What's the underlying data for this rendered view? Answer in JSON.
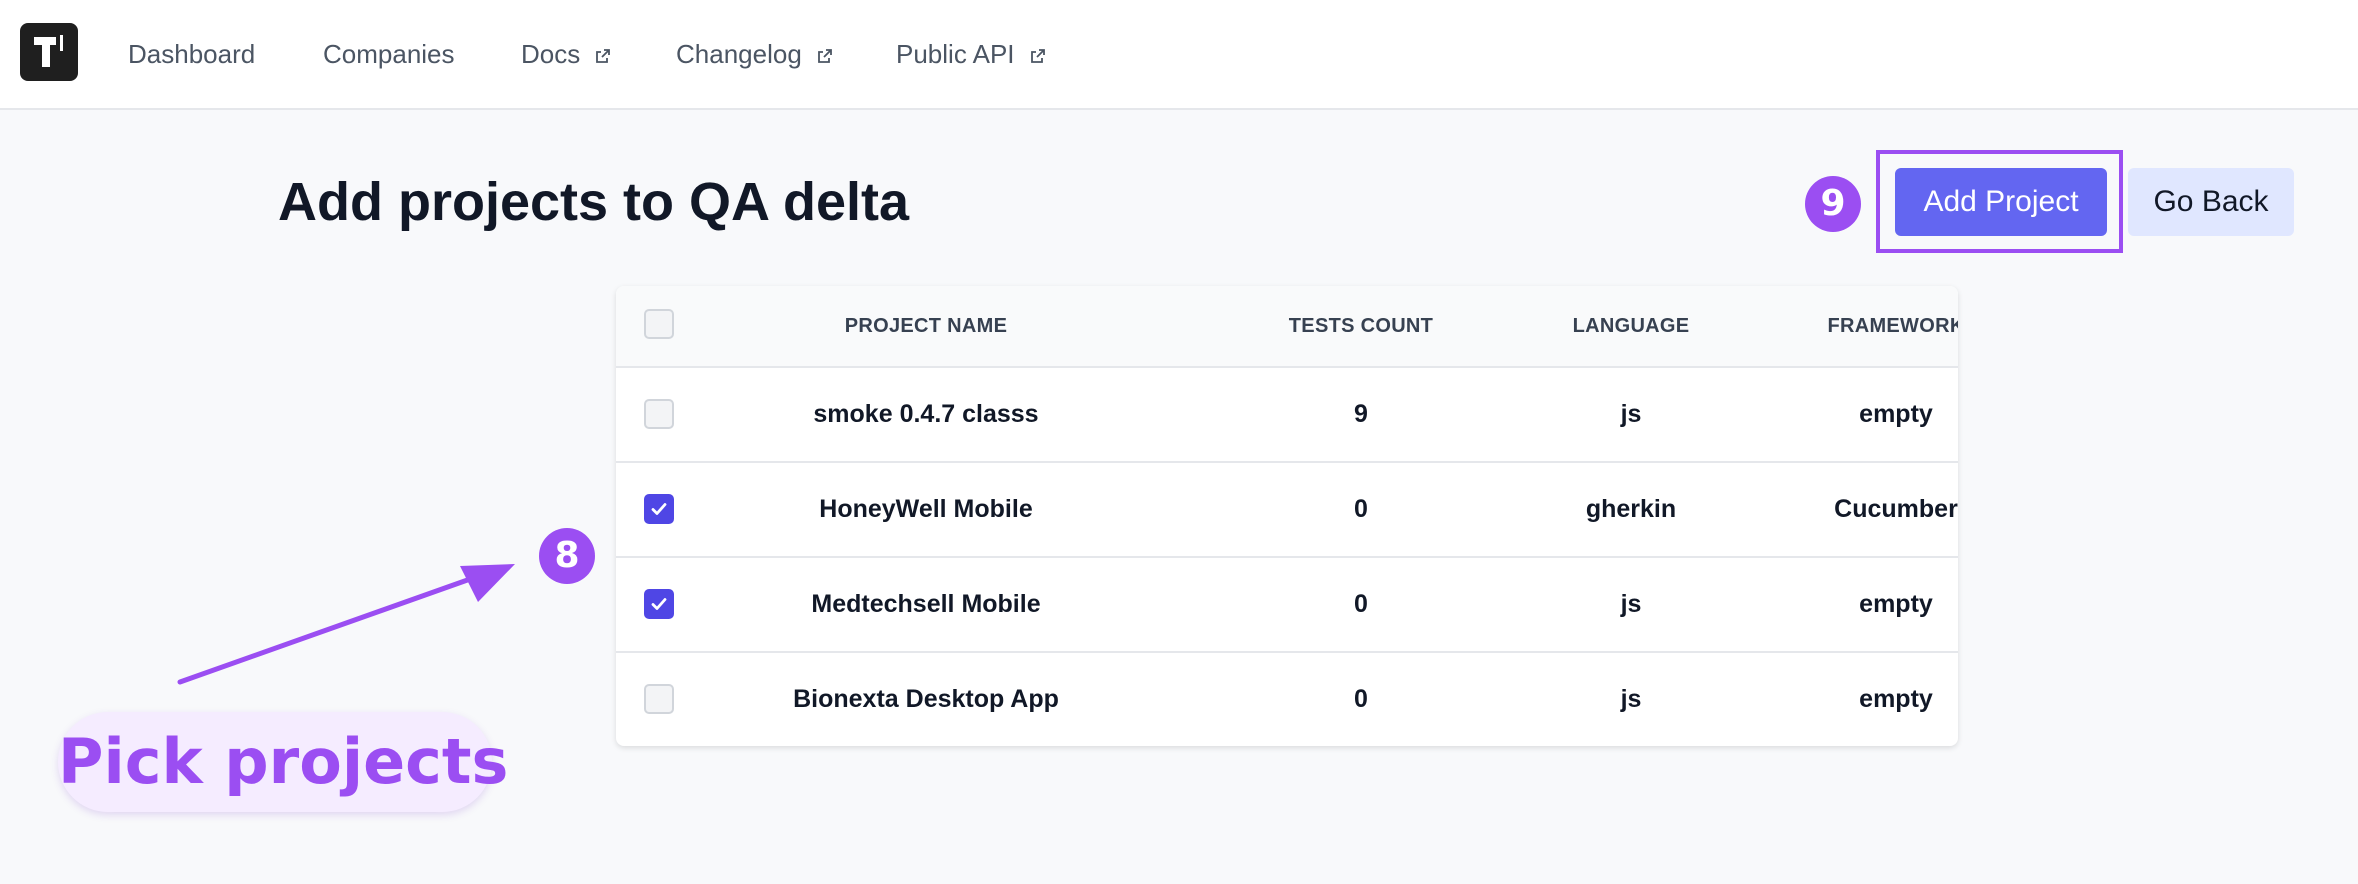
{
  "nav": {
    "items": [
      {
        "label": "Dashboard",
        "external": false
      },
      {
        "label": "Companies",
        "external": false
      },
      {
        "label": "Docs",
        "external": true
      },
      {
        "label": "Changelog",
        "external": true
      },
      {
        "label": "Public API",
        "external": true
      }
    ]
  },
  "page": {
    "title": "Add projects to QA delta",
    "add_button": "Add Project",
    "back_button": "Go Back"
  },
  "table": {
    "columns": [
      "PROJECT NAME",
      "TESTS COUNT",
      "LANGUAGE",
      "FRAMEWORK"
    ],
    "rows": [
      {
        "name": "smoke 0.4.7 classs",
        "tests_count": "9",
        "language": "js",
        "framework": "empty",
        "checked": false
      },
      {
        "name": "HoneyWell Mobile",
        "tests_count": "0",
        "language": "gherkin",
        "framework": "Cucumber",
        "checked": true
      },
      {
        "name": "Medtechsell Mobile",
        "tests_count": "0",
        "language": "js",
        "framework": "empty",
        "checked": true
      },
      {
        "name": "Bionexta Desktop App",
        "tests_count": "0",
        "language": "js",
        "framework": "empty",
        "checked": false
      }
    ]
  },
  "annotations": {
    "step_8": "8",
    "step_9": "9",
    "callout": "Pick projects"
  },
  "colors": {
    "accent": "#6366f1",
    "annotation": "#9b4ef2",
    "checkbox_checked": "#4f46e5"
  }
}
